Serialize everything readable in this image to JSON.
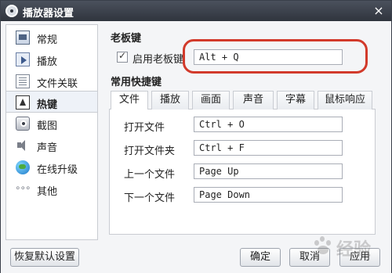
{
  "window": {
    "title": "播放器设置",
    "close_glyph": "×"
  },
  "sidebar": {
    "items": [
      {
        "label": "常规",
        "icon": "general-icon"
      },
      {
        "label": "播放",
        "icon": "play-icon"
      },
      {
        "label": "文件关联",
        "icon": "file-association-icon"
      },
      {
        "label": "热键",
        "icon": "hotkey-icon",
        "active": true
      },
      {
        "label": "截图",
        "icon": "camera-icon"
      },
      {
        "label": "声音",
        "icon": "speaker-icon"
      },
      {
        "label": "在线升级",
        "icon": "globe-icon"
      },
      {
        "label": "其他",
        "icon": "more-icon"
      }
    ]
  },
  "boss_key": {
    "section_title": "老板键",
    "checkbox_label": "启用老板键",
    "checked": true,
    "value": "Alt + Q",
    "highlight_color": "#d23a2b"
  },
  "shortcuts": {
    "section_title": "常用快捷键",
    "tabs": [
      "文件",
      "播放",
      "画面",
      "声音",
      "字幕",
      "鼠标响应"
    ],
    "active_tab": "文件",
    "rows": [
      {
        "label": "打开文件",
        "value": "Ctrl + O"
      },
      {
        "label": "打开文件夹",
        "value": "Ctrl + F"
      },
      {
        "label": "上一个文件",
        "value": "Page Up"
      },
      {
        "label": "下一个文件",
        "value": "Page Down"
      }
    ]
  },
  "buttons": {
    "restore_defaults": "恢复默认设置",
    "ok": "确定",
    "cancel": "取消",
    "apply": "应用"
  },
  "watermark": {
    "text": "经验"
  }
}
